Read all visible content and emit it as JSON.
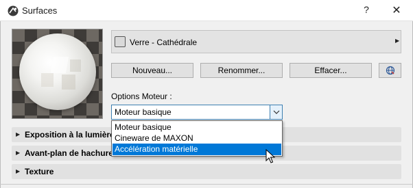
{
  "window": {
    "title": "Surfaces",
    "help_label": "?",
    "close_label": "✕"
  },
  "material": {
    "name": "Verre - Cathédrale",
    "arrow": "▶"
  },
  "buttons": {
    "new": "Nouveau...",
    "rename": "Renommer...",
    "delete": "Effacer..."
  },
  "engine": {
    "label": "Options Moteur :",
    "selected": "Moteur basique",
    "options": [
      "Moteur basique",
      "Cineware de MAXON",
      "Accélération matérielle"
    ],
    "highlighted_index": 2
  },
  "sections": [
    {
      "label": "Exposition à la lumière",
      "arrow": "▶"
    },
    {
      "label": "Avant-plan de hachure d",
      "arrow": "▶"
    },
    {
      "label": "Texture",
      "arrow": "▶"
    }
  ],
  "colors": {
    "accent": "#0078d7",
    "focus_border": "#3c7fb1"
  },
  "icons": {
    "app": "archicad-logo-icon",
    "globe": "globe-icon",
    "dropdown": "chevron-down-icon",
    "cursor": "mouse-pointer-icon"
  }
}
